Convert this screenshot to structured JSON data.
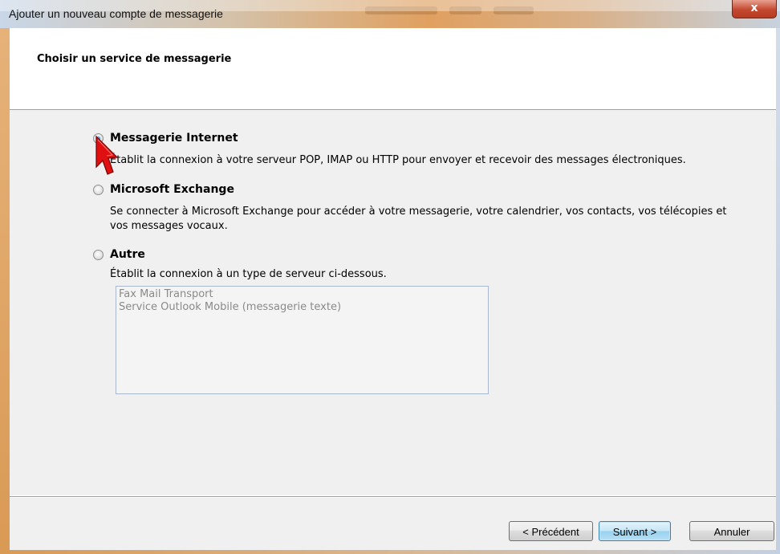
{
  "window": {
    "title": "Ajouter un nouveau compte de messagerie",
    "close_glyph": "x"
  },
  "header": {
    "title": "Choisir un service de messagerie"
  },
  "options": [
    {
      "label": "Messagerie Internet",
      "description": "Établit la connexion à votre serveur POP, IMAP ou HTTP pour envoyer et recevoir des messages électroniques.",
      "selected": true
    },
    {
      "label": "Microsoft Exchange",
      "description_line1": "Se connecter à Microsoft Exchange pour accéder à votre messagerie, votre calendrier, vos contacts, vos télécopies et",
      "description_line2": "vos messages vocaux.",
      "selected": false
    },
    {
      "label": "Autre",
      "description": "Établit la connexion à un type de serveur ci-dessous.",
      "selected": false
    }
  ],
  "server_list": {
    "items": [
      "Fax Mail Transport",
      "Service Outlook Mobile (messagerie texte)"
    ],
    "disabled": true
  },
  "buttons": {
    "back": "< Précédent",
    "next": "Suivant >",
    "cancel": "Annuler"
  },
  "colors": {
    "cursor": "#e01010",
    "default_button_border": "#3c7fb1",
    "close_button": "#c4482f"
  }
}
